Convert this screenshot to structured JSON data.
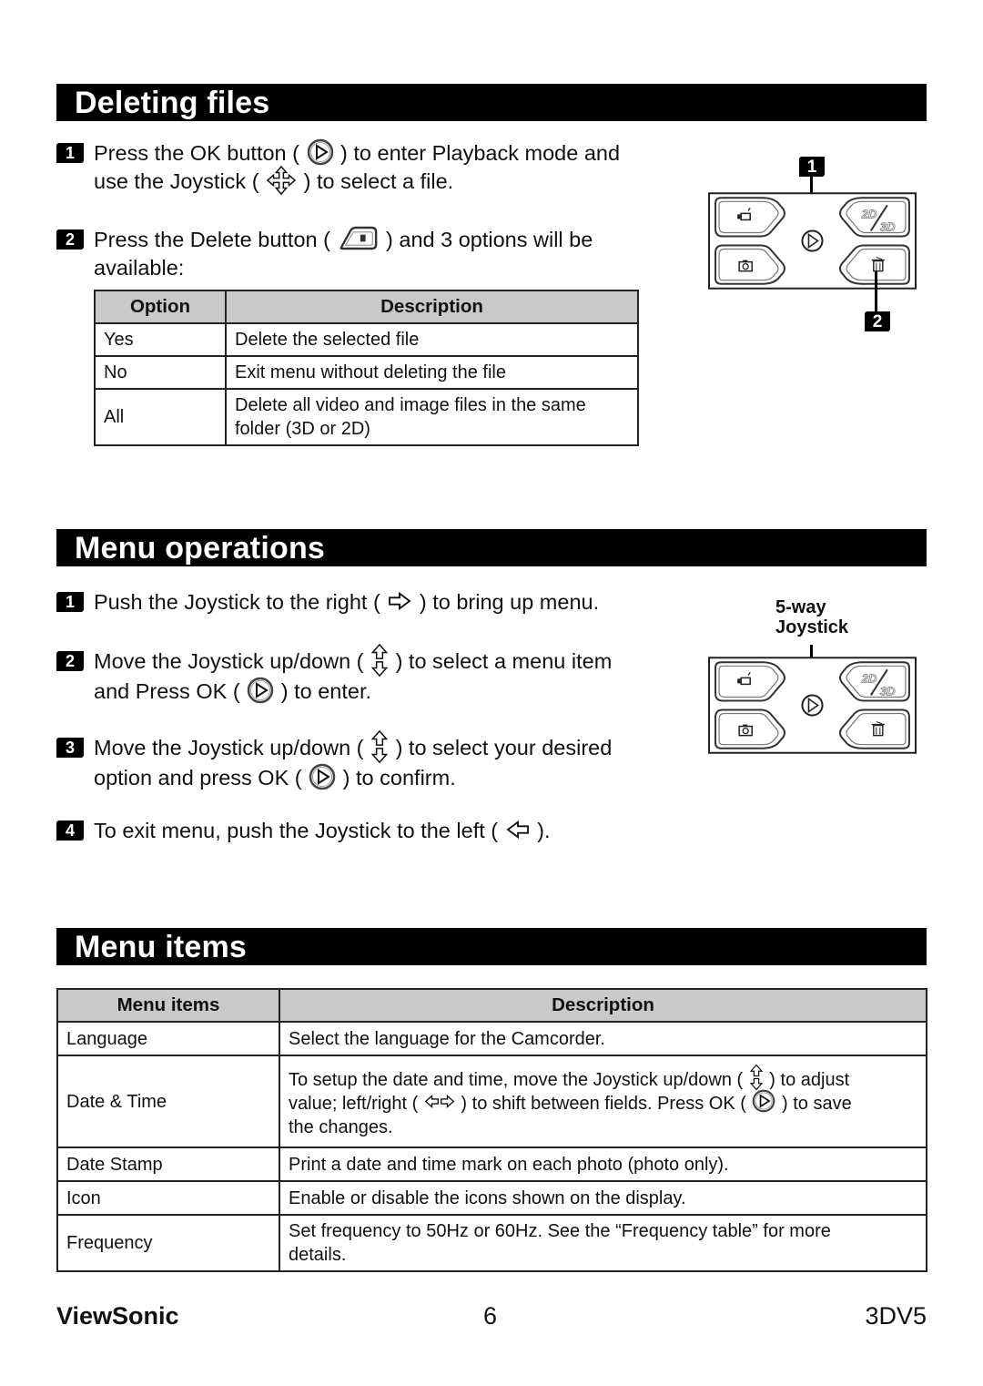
{
  "sections": {
    "deleting": {
      "title": "Deleting files",
      "steps": [
        {
          "number": "1",
          "parts": [
            "Press the OK button (",
            ") to enter Playback mode and",
            "use the Joystick (",
            ") to select a file."
          ],
          "icons": [
            "ok-button-icon",
            "joystick-icon"
          ]
        },
        {
          "number": "2",
          "parts": [
            "Press the Delete button (",
            ") and 3 options will be",
            "available:"
          ],
          "icons": [
            "delete-button-icon"
          ]
        }
      ],
      "table": {
        "headers": [
          "Option",
          "Description"
        ],
        "rows": [
          [
            "Yes",
            "Delete the selected file"
          ],
          [
            "No",
            "Exit menu without deleting the file"
          ],
          [
            "All",
            "Delete all video and image files in the same folder (3D or 2D)"
          ]
        ]
      },
      "diagram_callouts": [
        "1",
        "2"
      ]
    },
    "menu_ops": {
      "title": "Menu operations",
      "steps": [
        {
          "number": "1",
          "parts": [
            "Push the Joystick to the right (",
            ") to bring up menu."
          ],
          "icons": [
            "right-arrow-icon"
          ]
        },
        {
          "number": "2",
          "parts": [
            "Move the Joystick up/down (",
            ") to select a menu item",
            "and Press OK (",
            ") to enter."
          ],
          "icons": [
            "up-down-arrow-icon",
            "ok-button-icon"
          ]
        },
        {
          "number": "3",
          "parts": [
            "Move the Joystick up/down (",
            ") to select your desired",
            "option and press OK (",
            ") to confirm."
          ],
          "icons": [
            "up-down-arrow-icon",
            "ok-button-icon"
          ]
        },
        {
          "number": "4",
          "parts": [
            "To exit menu, push the Joystick to the left (",
            ")."
          ],
          "icons": [
            "left-arrow-icon"
          ]
        }
      ],
      "diagram_label_line1": "5-way",
      "diagram_label_line2": "Joystick"
    },
    "menu_items": {
      "title": "Menu items",
      "table": {
        "headers": [
          "Menu items",
          "Description"
        ],
        "rows": [
          [
            "Language",
            "Select the language for the Camcorder."
          ],
          [
            "Date & Time",
            "To setup the date and time, move the Joystick up/down ( ⇕ ) to adjust value; left/right ( ⇔ ) to shift between fields. Press OK ( ▷ ) to save the changes."
          ],
          [
            "Date Stamp",
            "Print a date and time mark on each photo (photo only)."
          ],
          [
            "Icon",
            "Enable or disable the icons shown on the display."
          ],
          [
            "Frequency",
            "Set frequency to 50Hz or 60Hz. See the “Frequency table” for more details."
          ]
        ],
        "datetime_parts": [
          "To setup the date and time, move the Joystick up/down (",
          ") to adjust",
          "value; left/right (",
          ") to shift between fields. Press OK (",
          ") to save",
          "the changes."
        ]
      }
    }
  },
  "diagram": {
    "button_labels": {
      "top_right_2d": "2D",
      "top_right_3d": "3D"
    }
  },
  "footer": {
    "brand": "ViewSonic",
    "page": "6",
    "model": "3DV5"
  }
}
